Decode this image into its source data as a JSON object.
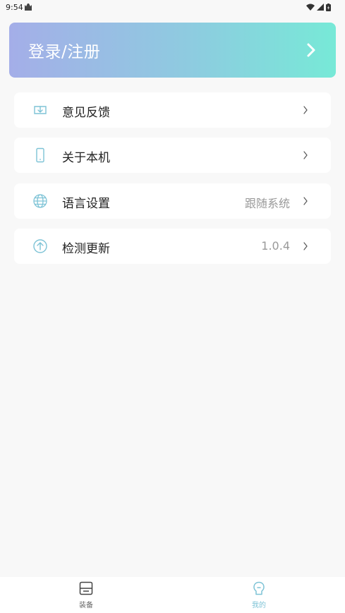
{
  "status_bar": {
    "time": "9:54"
  },
  "login": {
    "label": "登录/注册"
  },
  "menu": [
    {
      "icon": "feedback-icon",
      "label": "意见反馈",
      "value": ""
    },
    {
      "icon": "phone-icon",
      "label": "关于本机",
      "value": ""
    },
    {
      "icon": "globe-icon",
      "label": "语言设置",
      "value": "跟随系统"
    },
    {
      "icon": "update-arrow-icon",
      "label": "检测更新",
      "value": "1.0.4"
    }
  ],
  "bottom_nav": {
    "tabs": [
      {
        "icon": "device-icon",
        "label": "装备",
        "active": false
      },
      {
        "icon": "profile-icon",
        "label": "我的",
        "active": true
      }
    ]
  },
  "colors": {
    "icon_accent": "#7ec3d6",
    "banner_gradient_start": "#a4aee8",
    "banner_gradient_end": "#77e9d7",
    "active_tab": "#7ec3d6"
  }
}
